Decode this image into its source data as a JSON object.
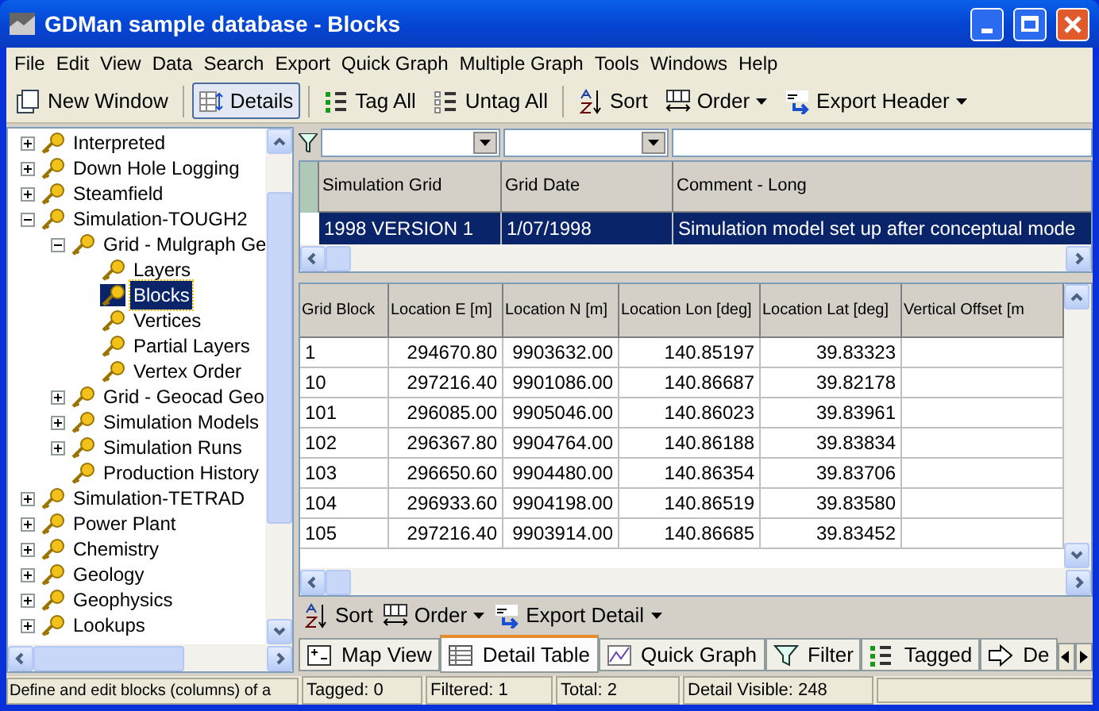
{
  "window": {
    "title": "GDMan sample database - Blocks"
  },
  "menu": [
    "File",
    "Edit",
    "View",
    "Data",
    "Search",
    "Export",
    "Quick Graph",
    "Multiple Graph",
    "Tools",
    "Windows",
    "Help"
  ],
  "toolbar": [
    {
      "kind": "window",
      "label": "New Window",
      "pressed": false,
      "dropdown": false
    },
    {
      "kind": "details",
      "label": "Details",
      "pressed": true,
      "dropdown": false
    },
    {
      "kind": "tag",
      "label": "Tag All",
      "pressed": false,
      "dropdown": false
    },
    {
      "kind": "untag",
      "label": "Untag All",
      "pressed": false,
      "dropdown": false
    },
    {
      "kind": "sort",
      "label": "Sort",
      "pressed": false,
      "dropdown": false
    },
    {
      "kind": "order",
      "label": "Order",
      "pressed": false,
      "dropdown": true
    },
    {
      "kind": "csv",
      "label": "Export Header",
      "pressed": false,
      "dropdown": true
    }
  ],
  "tree": [
    {
      "label": "Interpreted",
      "expanded": false,
      "selected": false
    },
    {
      "label": "Down Hole Logging",
      "expanded": false,
      "selected": false
    },
    {
      "label": "Steamfield",
      "expanded": false,
      "selected": false
    },
    {
      "label": "Simulation-TOUGH2",
      "expanded": true,
      "selected": false,
      "children": [
        {
          "label": "Grid - Mulgraph Ge",
          "expanded": true,
          "selected": false,
          "children": [
            {
              "label": "Layers",
              "selected": false
            },
            {
              "label": "Blocks",
              "selected": true
            },
            {
              "label": "Vertices",
              "selected": false
            },
            {
              "label": "Partial Layers",
              "selected": false
            },
            {
              "label": "Vertex Order",
              "selected": false
            }
          ]
        },
        {
          "label": "Grid - Geocad Geo",
          "expanded": false,
          "selected": false
        },
        {
          "label": "Simulation Models",
          "expanded": false,
          "selected": false
        },
        {
          "label": "Simulation Runs",
          "expanded": false,
          "selected": false
        },
        {
          "label": "Production History",
          "selected": false
        }
      ]
    },
    {
      "label": "Simulation-TETRAD",
      "expanded": false,
      "selected": false
    },
    {
      "label": "Power Plant",
      "expanded": false,
      "selected": false
    },
    {
      "label": "Chemistry",
      "expanded": false,
      "selected": false
    },
    {
      "label": "Geology",
      "expanded": false,
      "selected": false
    },
    {
      "label": "Geophysics",
      "expanded": false,
      "selected": false
    },
    {
      "label": "Lookups",
      "expanded": false,
      "selected": false
    }
  ],
  "header_table": {
    "columns": [
      "Simulation Grid",
      "Grid Date",
      "Comment - Long"
    ],
    "rows": [
      {
        "selected": true,
        "cells": [
          "1998 VERSION 1",
          "1/07/1998",
          "Simulation model set up after conceptual mode"
        ]
      }
    ]
  },
  "detail_table": {
    "columns": [
      "Grid Block",
      "Location E [m]",
      "Location N [m]",
      "Location Lon [deg]",
      "Location Lat [deg]",
      "Vertical Offset [m"
    ],
    "rows": [
      [
        "1",
        "294670.80",
        "9903632.00",
        "140.85197",
        "39.83323"
      ],
      [
        "10",
        "297216.40",
        "9901086.00",
        "140.86687",
        "39.82178"
      ],
      [
        "101",
        "296085.00",
        "9905046.00",
        "140.86023",
        "39.83961"
      ],
      [
        "102",
        "296367.80",
        "9904764.00",
        "140.86188",
        "39.83834"
      ],
      [
        "103",
        "296650.60",
        "9904480.00",
        "140.86354",
        "39.83706"
      ],
      [
        "104",
        "296933.60",
        "9904198.00",
        "140.86519",
        "39.83580"
      ],
      [
        "105",
        "297216.40",
        "9903914.00",
        "140.86685",
        "39.83452"
      ]
    ]
  },
  "detail_toolbar": [
    {
      "kind": "sort",
      "label": "Sort",
      "dropdown": false
    },
    {
      "kind": "order",
      "label": "Order",
      "dropdown": true
    },
    {
      "kind": "csv",
      "label": "Export Detail",
      "dropdown": true
    }
  ],
  "tabs": [
    {
      "kind": "map",
      "label": "Map View",
      "selected": false
    },
    {
      "kind": "table",
      "label": "Detail Table",
      "selected": true
    },
    {
      "kind": "graph",
      "label": "Quick Graph",
      "selected": false
    },
    {
      "kind": "filter",
      "label": "Filter",
      "selected": false
    },
    {
      "kind": "tag",
      "label": "Tagged",
      "selected": false
    },
    {
      "kind": "arrow",
      "label": "De",
      "selected": false
    }
  ],
  "status_bar": {
    "hint": "Define and edit blocks (columns) of a",
    "panels": [
      "Tagged: 0",
      "Filtered: 1",
      "Total: 2",
      "Detail Visible: 248"
    ]
  }
}
